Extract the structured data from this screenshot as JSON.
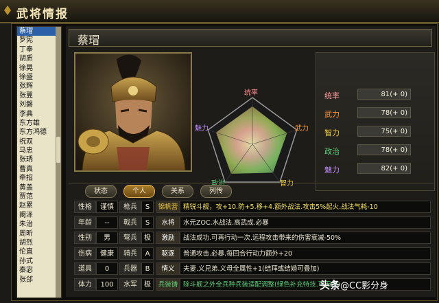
{
  "window": {
    "title": "武将情报"
  },
  "sidebar": {
    "items": [
      "蔡瑁",
      "罗宪",
      "丁奉",
      "胡质",
      "徐晃",
      "徐盛",
      "张辉",
      "张翼",
      "刘磐",
      "李典",
      "东方雄",
      "东方鸿德",
      "祝双",
      "马忠",
      "张琇",
      "曹真",
      "牵招",
      "黄盖",
      "贾范",
      "赵累",
      "阚泽",
      "朱治",
      "周昕",
      "胡烈",
      "伦直",
      "孙式",
      "秦宓",
      "张郃"
    ],
    "selected_index": 0
  },
  "officer": {
    "name": "蔡瑁"
  },
  "radar": {
    "labels": {
      "top": "统率",
      "right": "武力",
      "bottom_right": "智力",
      "bottom_left": "政治",
      "left": "魅力"
    },
    "values": [
      81,
      78,
      75,
      78,
      82
    ],
    "max": 100
  },
  "stats": [
    {
      "label": "统率",
      "value": "81(+ 0)",
      "color": "#ff9a9a"
    },
    {
      "label": "武力",
      "value": "78(+ 0)",
      "color": "#ff9a3a"
    },
    {
      "label": "智力",
      "value": "75(+ 0)",
      "color": "#f0d040"
    },
    {
      "label": "政治",
      "value": "78(+ 0)",
      "color": "#5fd07a"
    },
    {
      "label": "魅力",
      "value": "82(+ 0)",
      "color": "#c08aff"
    }
  ],
  "tabs": [
    "状态",
    "个人",
    "关系",
    "列传"
  ],
  "active_tab": 1,
  "info_rows": [
    {
      "k1": "性格",
      "v1": "谨慎",
      "k2": "枪兵",
      "v2": "S",
      "skill": "锦帆营",
      "skill_color": "#f0c840",
      "desc": "精锐斗舰，攻+10.防+5.移+4.额外战法.攻击5%起火.战法气耗-10",
      "desc_color": "#f5e060"
    },
    {
      "k1": "年龄",
      "v1": "--",
      "k2": "戟兵",
      "v2": "S",
      "skill": "水将",
      "skill_color": "#ffffff",
      "desc": "水元ZOC.水战法.高武成.必暴",
      "desc_color": "#e9e3cf"
    },
    {
      "k1": "性别",
      "v1": "男",
      "k2": "弩兵",
      "v2": "极",
      "skill": "激励",
      "skill_color": "#ffffff",
      "desc": "战法成功.可再行动一次.远程攻击带来的伤害衰减-50%",
      "desc_color": "#e9e3cf"
    },
    {
      "k1": "伤病",
      "v1": "健康",
      "k2": "骑兵",
      "v2": "A",
      "skill": "驱逐",
      "skill_color": "#ffffff",
      "desc": "普通攻击.必暴.每回合行动力额外+20",
      "desc_color": "#e9e3cf"
    },
    {
      "k1": "道具",
      "v1": "0",
      "k2": "兵器",
      "v2": "B",
      "skill": "情义",
      "skill_color": "#ffffff",
      "desc": "夫妻.义兄弟.义母全属性+1(结拜或结婚可叠加)",
      "desc_color": "#e9e3cf"
    },
    {
      "k1": "体力",
      "v1": "100",
      "k2": "水军",
      "v2": "极",
      "skill": "兵装铸",
      "skill_color": "#5fd07a",
      "desc": "除斗舰之外全兵种兵装适配调整(绿色补充特技.可无视)",
      "desc_color": "#5fd07a"
    }
  ],
  "watermark": {
    "main": "头条",
    "sub": "@CC影分身"
  }
}
